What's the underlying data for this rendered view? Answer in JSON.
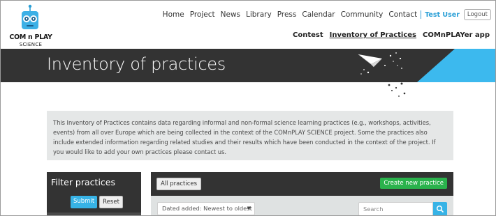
{
  "logo": {
    "line1": "COM n PLAY",
    "line2": "SCIENCE",
    "brand_blue": "#2a9fd6"
  },
  "topnav": {
    "links": [
      "Home",
      "Project",
      "News",
      "Library",
      "Press",
      "Calendar",
      "Community",
      "Contact"
    ],
    "user": "Test User",
    "logout": "Logout"
  },
  "subnav": {
    "links": [
      "Contest",
      "Inventory of Practices",
      "COMnPLAYer app"
    ],
    "active": "Inventory of Practices"
  },
  "banner": {
    "title": "Inventory of practices",
    "background": "#333333",
    "accent": "#3cb9ee"
  },
  "intro": {
    "text": "This Inventory of Practices contains data regarding informal and non-formal science learning practices (e.g., workshops, activities, events) from all over Europe which are being collected in the context of the COMnPLAY SCIENCE project. Some the practices also include extended information regarding related studies and their results which have been conducted in the context of the project. If you would like to add your own practices please contact us."
  },
  "filter": {
    "title": "Filter practices",
    "submit": "Submit",
    "reset": "Reset"
  },
  "list": {
    "all_button": "All practices",
    "create_button": "Create new practice",
    "sort_value": "Dated added: Newest to oldest",
    "search_placeholder": "Search",
    "create_color": "#2ab24c"
  }
}
